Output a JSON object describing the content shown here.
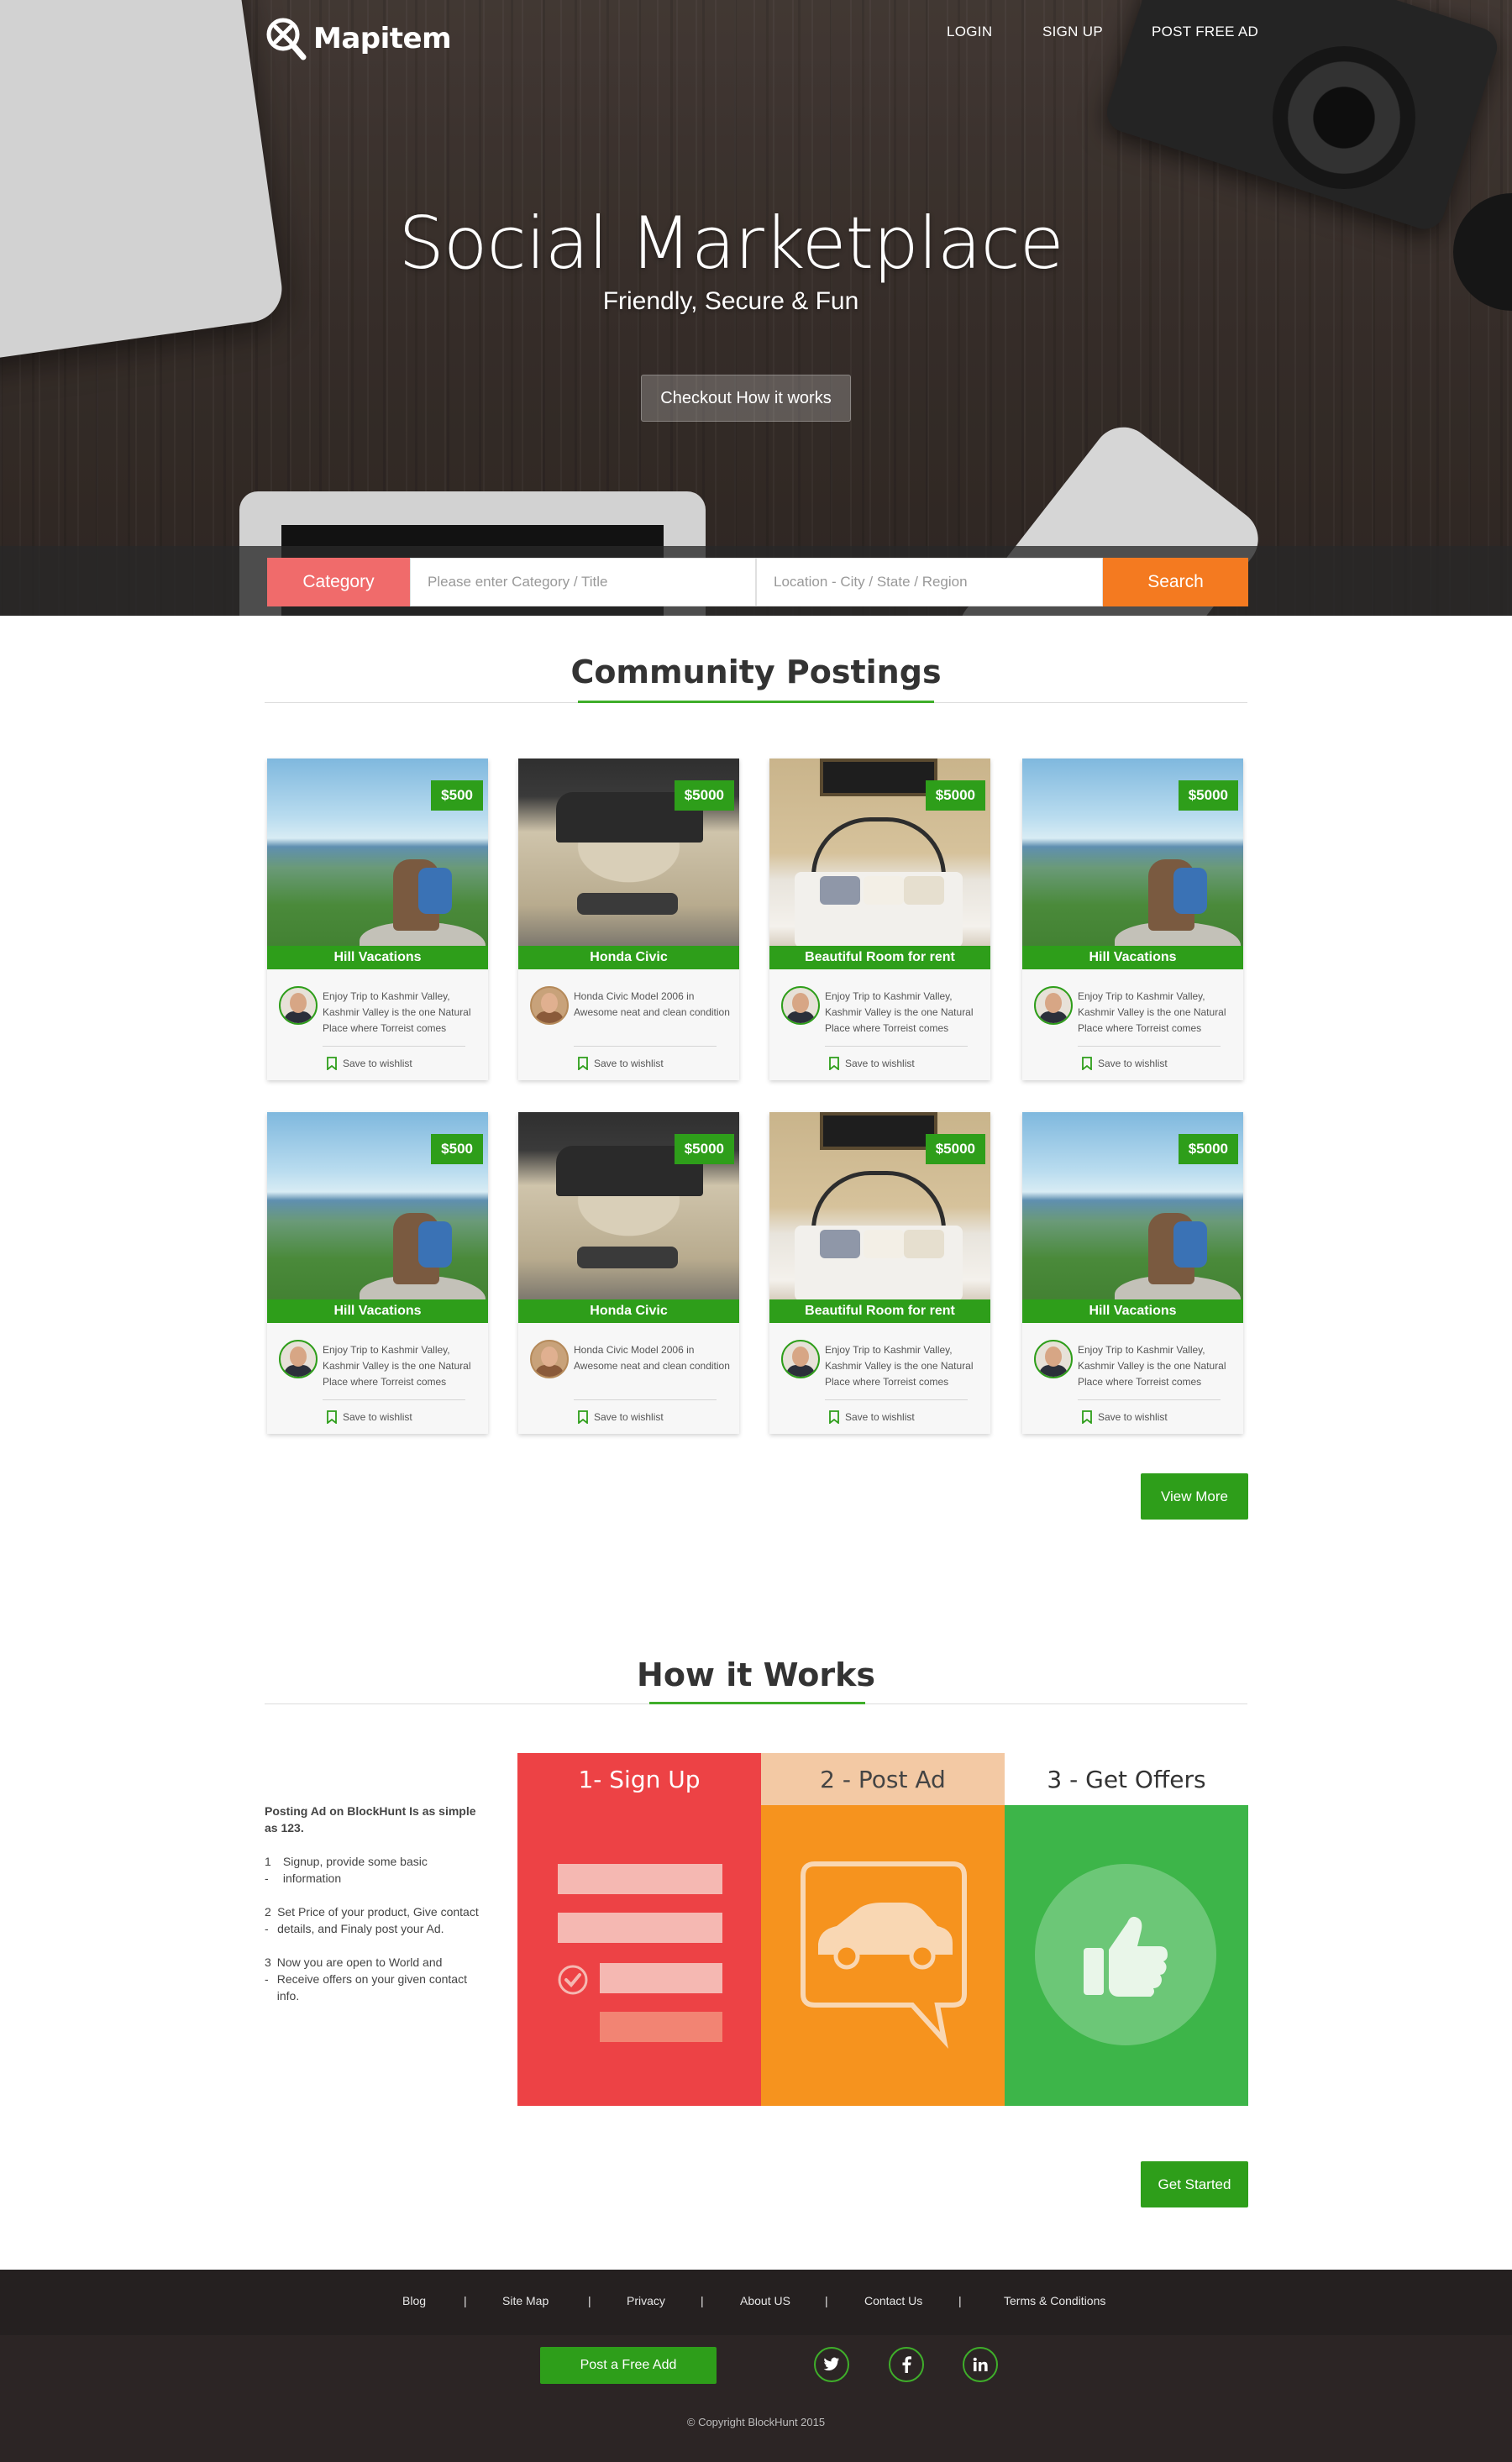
{
  "brand": {
    "logo_text": "Mapitem"
  },
  "nav": {
    "items": [
      "LOGIN",
      "SIGN UP",
      "POST FREE AD"
    ]
  },
  "hero": {
    "title": "Social Marketplace",
    "subtitle": "Friendly, Secure & Fun",
    "cta_label": "Checkout How it works"
  },
  "search": {
    "category_label": "Category",
    "title_placeholder": "Please enter Category / Title",
    "location_placeholder": "Location - City / State / Region",
    "search_label": "Search"
  },
  "community": {
    "heading": "Community Postings",
    "save_label": "Save to wishlist",
    "view_more_label": "View More",
    "cards": [
      {
        "price": "$500",
        "title": "Hill Vacations",
        "image": "hill",
        "avatar": "male",
        "desc": "Enjoy Trip to Kashmir Valley, Kashmir Valley is the one Natural Place where Torreist comes"
      },
      {
        "price": "$5000",
        "title": "Honda Civic",
        "image": "car",
        "avatar": "female",
        "desc": "Honda Civic Model 2006 in Awesome neat and clean condition"
      },
      {
        "price": "$5000",
        "title": "Beautiful Room for rent",
        "image": "room",
        "avatar": "male",
        "desc": "Enjoy Trip to Kashmir Valley, Kashmir Valley is the one Natural Place where Torreist comes"
      },
      {
        "price": "$5000",
        "title": "Hill Vacations",
        "image": "hill",
        "avatar": "male",
        "desc": "Enjoy Trip to Kashmir Valley, Kashmir Valley is the one Natural Place where Torreist comes"
      },
      {
        "price": "$500",
        "title": "Hill Vacations",
        "image": "hill",
        "avatar": "male",
        "desc": "Enjoy Trip to Kashmir Valley, Kashmir Valley is the one Natural Place where Torreist comes"
      },
      {
        "price": "$5000",
        "title": "Honda Civic",
        "image": "car",
        "avatar": "female",
        "desc": "Honda Civic Model 2006 in Awesome neat and clean condition"
      },
      {
        "price": "$5000",
        "title": "Beautiful Room for rent",
        "image": "room",
        "avatar": "male",
        "desc": "Enjoy Trip to Kashmir Valley, Kashmir Valley is the one Natural Place where Torreist comes"
      },
      {
        "price": "$5000",
        "title": "Hill Vacations",
        "image": "hill",
        "avatar": "male",
        "desc": "Enjoy Trip to Kashmir Valley, Kashmir Valley is the one Natural Place where Torreist comes"
      }
    ]
  },
  "how": {
    "heading": "How it Works",
    "intro": "Posting Ad on BlockHunt Is as simple as 123.",
    "steps_text": [
      {
        "num": "1 -",
        "text": "Signup, provide some basic information"
      },
      {
        "num": "2 -",
        "text": "Set Price of your product, Give contact  details, and Finaly post your Ad."
      },
      {
        "num": "3 -",
        "text": "Now you are open to World and Receive offers on your given contact info."
      }
    ],
    "tabs": [
      "1- Sign Up",
      "2 - Post Ad",
      "3 - Get Offers"
    ],
    "get_started_label": "Get Started"
  },
  "footer": {
    "links": [
      "Blog",
      "Site Map",
      "Privacy",
      "About US",
      "Contact Us",
      "Terms & Conditions"
    ],
    "separator": "|",
    "post_label": "Post a Free Add",
    "social": [
      "twitter-icon",
      "facebook-icon",
      "linkedin-icon"
    ],
    "copyright": "© Copyright BlockHunt 2015"
  },
  "colors": {
    "green": "#2e9e1a",
    "red": "#ed4245",
    "orange": "#f6931e",
    "light_green": "#3db549",
    "search_orange": "#f47a20",
    "category_coral": "#f06b6b"
  }
}
